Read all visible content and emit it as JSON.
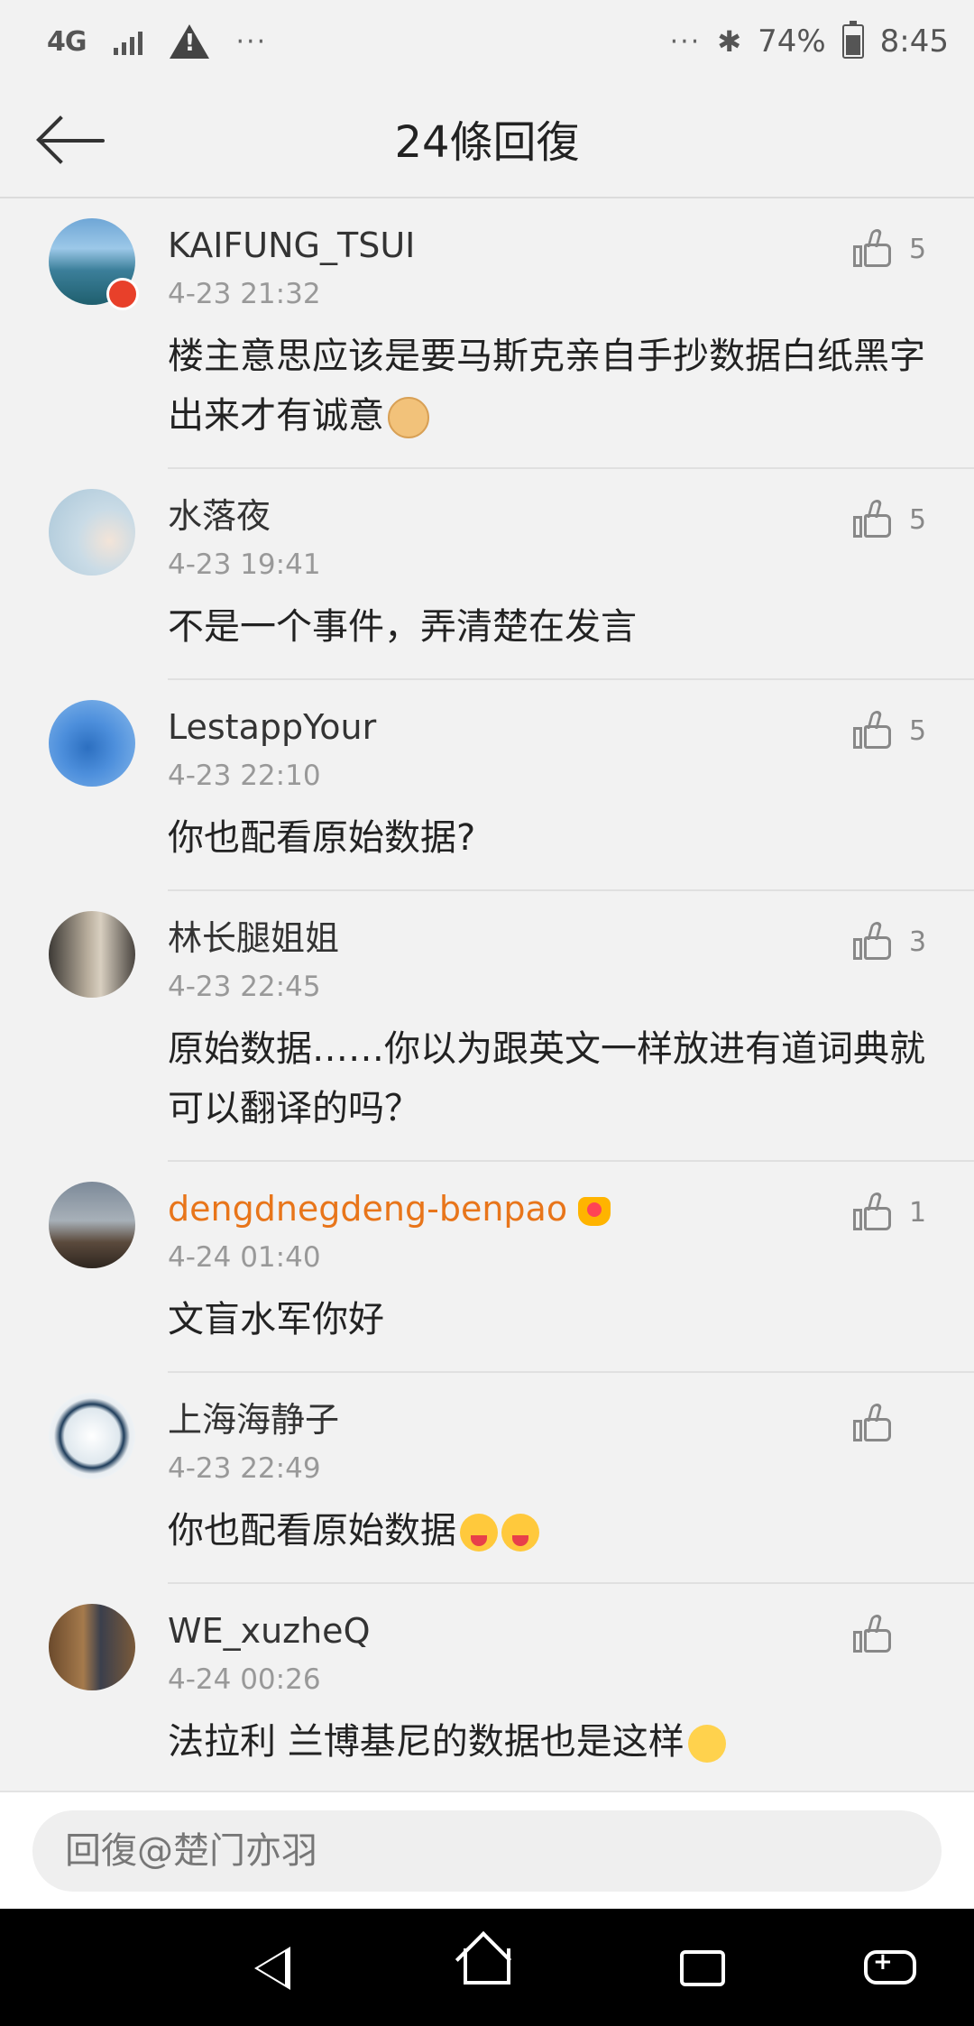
{
  "status_bar": {
    "network": "4G",
    "left_more": "···",
    "right_more": "···",
    "battery": "74%",
    "time": "8:45"
  },
  "header": {
    "title": "24條回復"
  },
  "comments": [
    {
      "name": "KAIFUNG_TSUI",
      "time": "4-23 21:32",
      "text": "楼主意思应该是要马斯克亲自手抄数据白纸黑字出来才有诚意",
      "likes": "5"
    },
    {
      "name": "水落夜",
      "time": "4-23 19:41",
      "text": "不是一个事件，弄清楚在发言",
      "likes": "5"
    },
    {
      "name": "LestappYour",
      "time": "4-23 22:10",
      "text": "你也配看原始数据?",
      "likes": "5"
    },
    {
      "name": "林长腿姐姐",
      "time": "4-23 22:45",
      "text": "原始数据……你以为跟英文一样放进有道词典就可以翻译的吗？",
      "likes": "3"
    },
    {
      "name": "dengdnegdeng-benpao",
      "time": "4-24 01:40",
      "text": "文盲水军你好",
      "likes": "1"
    },
    {
      "name": "上海海静子",
      "time": "4-23 22:49",
      "text": "你也配看原始数据",
      "likes": ""
    },
    {
      "name": "WE_xuzheQ",
      "time": "4-24 00:26",
      "text": "法拉利 兰博基尼的数据也是这样",
      "likes": ""
    }
  ],
  "reply": {
    "placeholder": "回復@楚门亦羽"
  },
  "icons": [
    "back-arrow-icon",
    "thumbs-up-icon",
    "warning-icon",
    "bluetooth-icon",
    "battery-icon",
    "nav-back-icon",
    "nav-home-icon",
    "nav-recents-icon",
    "nav-game-icon"
  ]
}
